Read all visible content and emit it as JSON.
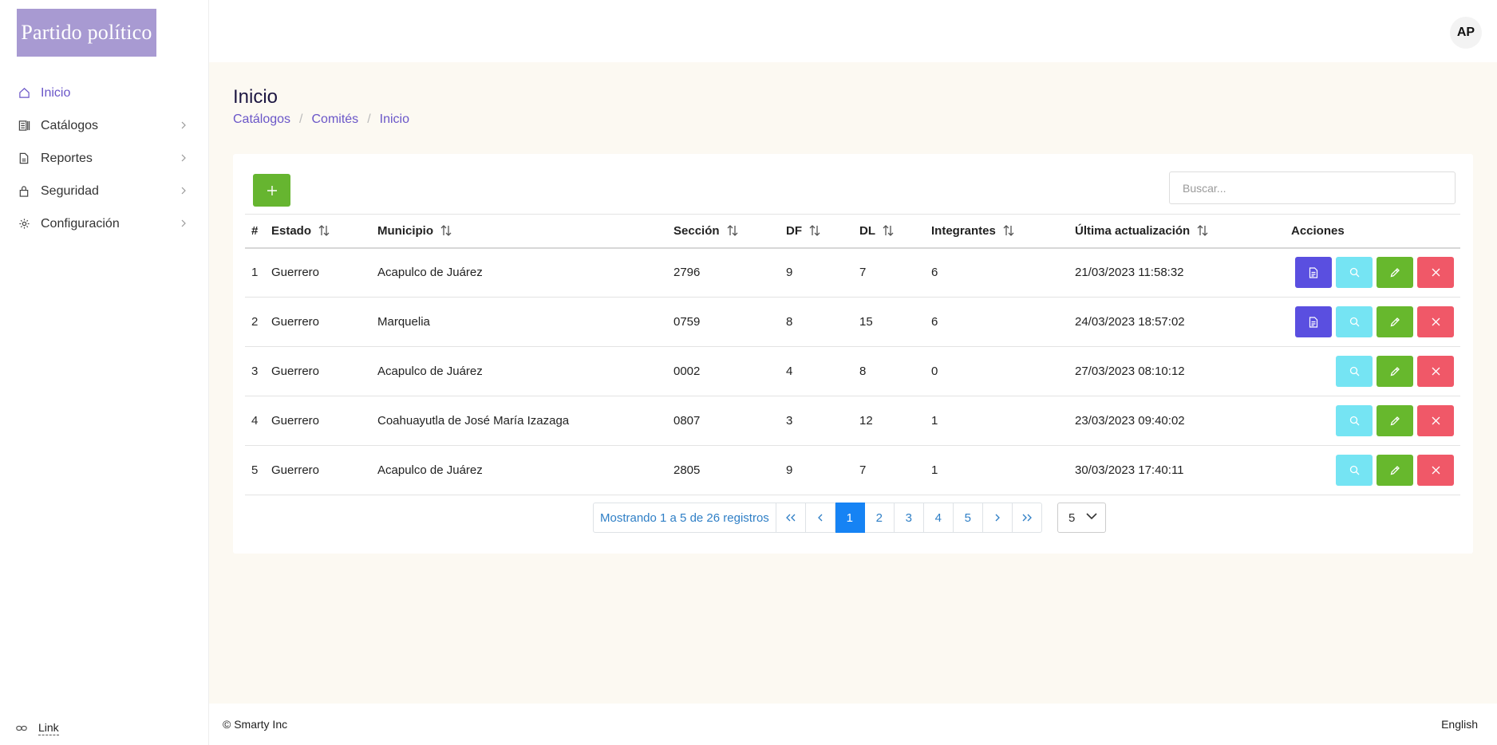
{
  "brand": {
    "logo_text": "Partido político",
    "logo_color": "#a89ad2"
  },
  "sidebar": {
    "items": [
      {
        "label": "Inicio",
        "icon": "home-icon",
        "active": true
      },
      {
        "label": "Catálogos",
        "icon": "catalog-icon",
        "has_submenu": true
      },
      {
        "label": "Reportes",
        "icon": "report-icon",
        "has_submenu": true
      },
      {
        "label": "Seguridad",
        "icon": "lock-icon",
        "has_submenu": true
      },
      {
        "label": "Configuración",
        "icon": "gear-icon",
        "has_submenu": true
      }
    ],
    "bottom_link": {
      "label": "Link",
      "icon": "link-icon"
    }
  },
  "topbar": {
    "avatar_initials": "AP"
  },
  "page": {
    "title": "Inicio",
    "breadcrumb": [
      "Catálogos",
      "Comités",
      "Inicio"
    ]
  },
  "toolbar": {
    "add_label": "+",
    "search_placeholder": "Buscar..."
  },
  "table": {
    "headers": [
      "#",
      "Estado",
      "Municipio",
      "Sección",
      "DF",
      "DL",
      "Integrantes",
      "Última actualización",
      "Acciones"
    ],
    "rows": [
      {
        "idx": "1",
        "estado": "Guerrero",
        "municipio": "Acapulco de Juárez",
        "seccion": "2796",
        "df": "9",
        "dl": "7",
        "integrantes": "6",
        "actualizacion": "21/03/2023 11:58:32",
        "has_doc": true
      },
      {
        "idx": "2",
        "estado": "Guerrero",
        "municipio": "Marquelia",
        "seccion": "0759",
        "df": "8",
        "dl": "15",
        "integrantes": "6",
        "actualizacion": "24/03/2023 18:57:02",
        "has_doc": true
      },
      {
        "idx": "3",
        "estado": "Guerrero",
        "municipio": "Acapulco de Juárez",
        "seccion": "0002",
        "df": "4",
        "dl": "8",
        "integrantes": "0",
        "actualizacion": "27/03/2023 08:10:12",
        "has_doc": false
      },
      {
        "idx": "4",
        "estado": "Guerrero",
        "municipio": "Coahuayutla de José María Izazaga",
        "seccion": "0807",
        "df": "3",
        "dl": "12",
        "integrantes": "1",
        "actualizacion": "23/03/2023 09:40:02",
        "has_doc": false
      },
      {
        "idx": "5",
        "estado": "Guerrero",
        "municipio": "Acapulco de Juárez",
        "seccion": "2805",
        "df": "9",
        "dl": "7",
        "integrantes": "1",
        "actualizacion": "30/03/2023 17:40:11",
        "has_doc": false
      }
    ]
  },
  "pagination": {
    "info": "Mostrando 1 a 5 de 26 registros",
    "pages": [
      "1",
      "2",
      "3",
      "4",
      "5"
    ],
    "current": "1",
    "per_page": "5"
  },
  "footer": {
    "copyright": "© Smarty Inc",
    "language": "English"
  },
  "colors": {
    "accent": "#6a56c8",
    "add": "#66b530",
    "doc": "#5a4fe0",
    "view": "#75e4f3",
    "edit": "#67b82d",
    "delete": "#f05868",
    "page_active": "#1683f4"
  }
}
